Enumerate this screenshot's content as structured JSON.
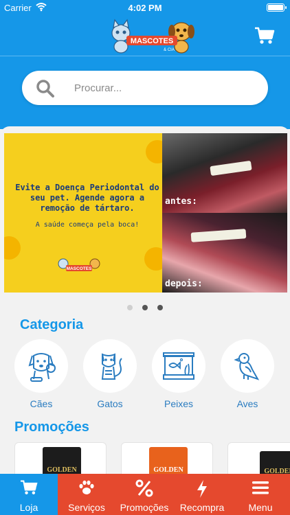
{
  "status": {
    "carrier": "Carrier",
    "time": "4:02 PM"
  },
  "header": {
    "logo_text": "MASCOTES",
    "logo_sub": "& CIA"
  },
  "search": {
    "placeholder": "Procurar..."
  },
  "banner": {
    "headline": "Evite a Doença Periodontal do seu pet. Agende agora a remoção de tártaro.",
    "tagline": "A saúde começa pela boca!",
    "before_label": "antes:",
    "after_label": "depois:",
    "logo_text": "MASCOTES"
  },
  "carousel": {
    "count": 3,
    "active": 1
  },
  "categories": {
    "title": "Categoria",
    "items": [
      {
        "label": "Cães",
        "icon": "dog-icon"
      },
      {
        "label": "Gatos",
        "icon": "cat-icon"
      },
      {
        "label": "Peixes",
        "icon": "aquarium-icon"
      },
      {
        "label": "Aves",
        "icon": "bird-icon"
      }
    ]
  },
  "promotions": {
    "title": "Promoções",
    "items": [
      {
        "brand": "GOLDEN",
        "color": "#1c1c1c"
      },
      {
        "brand": "GOLDEN",
        "color": "#e8621c"
      },
      {
        "brand": "GOLDEN",
        "color": "#1c1c1c"
      }
    ]
  },
  "tabs": [
    {
      "label": "Loja",
      "icon": "store-cart-icon",
      "active": true
    },
    {
      "label": "Serviços",
      "icon": "paw-icon",
      "active": false
    },
    {
      "label": "Promoções",
      "icon": "percent-icon",
      "active": false
    },
    {
      "label": "Recompra",
      "icon": "lightning-icon",
      "active": false
    },
    {
      "label": "Menu",
      "icon": "hamburger-icon",
      "active": false
    }
  ],
  "colors": {
    "primary": "#1597e8",
    "tabbar": "#e5492e",
    "accent_text": "#2a7cc0"
  }
}
